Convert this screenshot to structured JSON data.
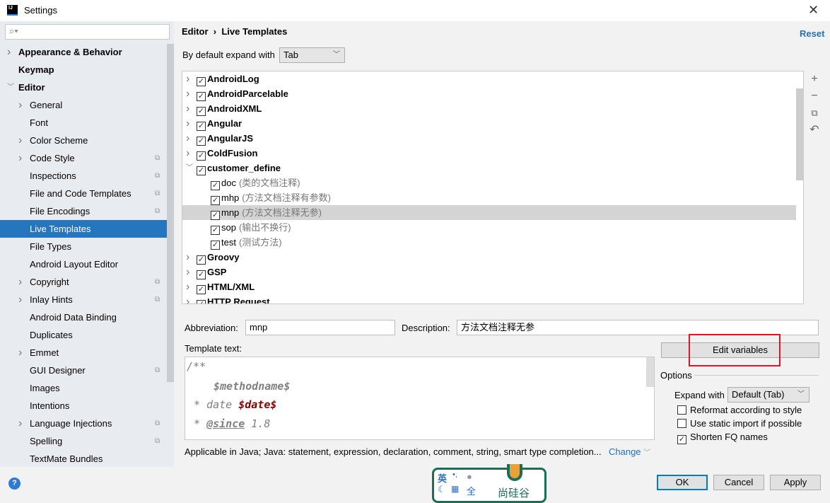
{
  "window": {
    "title": "Settings",
    "app_icon": "IJ"
  },
  "sidebar": {
    "search_placeholder": "",
    "items": [
      {
        "label": "Appearance & Behavior",
        "level": 0,
        "bold": true,
        "chevron": "right"
      },
      {
        "label": "Keymap",
        "level": 0,
        "bold": true
      },
      {
        "label": "Editor",
        "level": 0,
        "bold": true,
        "chevron": "down"
      },
      {
        "label": "General",
        "level": 1,
        "chevron": "right"
      },
      {
        "label": "Font",
        "level": 1
      },
      {
        "label": "Color Scheme",
        "level": 1,
        "chevron": "right"
      },
      {
        "label": "Code Style",
        "level": 1,
        "chevron": "right",
        "copy": true
      },
      {
        "label": "Inspections",
        "level": 1,
        "copy": true
      },
      {
        "label": "File and Code Templates",
        "level": 1,
        "copy": true
      },
      {
        "label": "File Encodings",
        "level": 1,
        "copy": true
      },
      {
        "label": "Live Templates",
        "level": 1,
        "selected": true
      },
      {
        "label": "File Types",
        "level": 1
      },
      {
        "label": "Android Layout Editor",
        "level": 1
      },
      {
        "label": "Copyright",
        "level": 1,
        "chevron": "right",
        "copy": true
      },
      {
        "label": "Inlay Hints",
        "level": 1,
        "chevron": "right",
        "copy": true
      },
      {
        "label": "Android Data Binding",
        "level": 1
      },
      {
        "label": "Duplicates",
        "level": 1
      },
      {
        "label": "Emmet",
        "level": 1,
        "chevron": "right"
      },
      {
        "label": "GUI Designer",
        "level": 1,
        "copy": true
      },
      {
        "label": "Images",
        "level": 1
      },
      {
        "label": "Intentions",
        "level": 1
      },
      {
        "label": "Language Injections",
        "level": 1,
        "chevron": "right",
        "copy": true
      },
      {
        "label": "Spelling",
        "level": 1,
        "copy": true
      },
      {
        "label": "TextMate Bundles",
        "level": 1
      }
    ]
  },
  "header": {
    "breadcrumb": [
      "Editor",
      "Live Templates"
    ],
    "reset": "Reset"
  },
  "expand": {
    "label": "By default expand with",
    "value": "Tab"
  },
  "tree": [
    {
      "name": "AndroidLog",
      "group": true,
      "checked": true
    },
    {
      "name": "AndroidParcelable",
      "group": true,
      "checked": true
    },
    {
      "name": "AndroidXML",
      "group": true,
      "checked": true
    },
    {
      "name": "Angular",
      "group": true,
      "checked": true
    },
    {
      "name": "AngularJS",
      "group": true,
      "checked": true
    },
    {
      "name": "ColdFusion",
      "group": true,
      "checked": true
    },
    {
      "name": "customer_define",
      "group": true,
      "checked": true,
      "expanded": true
    },
    {
      "name": "doc",
      "desc": "(类的文档注释)",
      "checked": true
    },
    {
      "name": "mhp",
      "desc": "(方法文档注释有参数)",
      "checked": true
    },
    {
      "name": "mnp",
      "desc": "(方法文档注释无参)",
      "checked": true,
      "selected": true
    },
    {
      "name": "sop",
      "desc": "(输出不换行)",
      "checked": true
    },
    {
      "name": "test",
      "desc": "(测试方法)",
      "checked": true
    },
    {
      "name": "Groovy",
      "group": true,
      "checked": true
    },
    {
      "name": "GSP",
      "group": true,
      "checked": true
    },
    {
      "name": "HTML/XML",
      "group": true,
      "checked": true
    },
    {
      "name": "HTTP Request",
      "group": true,
      "checked": true
    }
  ],
  "tree_tools": [
    "add-icon",
    "remove-icon",
    "copy-icon",
    "restore-icon"
  ],
  "form": {
    "abbreviation_label": "Abbreviation:",
    "abbreviation": "mnp",
    "description_label": "Description:",
    "description": "方法文档注释无参",
    "template_label": "Template text:",
    "edit_variables": "Edit variables"
  },
  "template": {
    "l1": "/**",
    "l2": "$methodname$",
    "l3a": "* date ",
    "l3b": "$date$",
    "l4a": "* ",
    "l4b": "@since",
    "l4c": " 1.8"
  },
  "applicable": {
    "text": "Applicable in Java; Java: statement, expression, declaration, comment, string, smart type completion...",
    "change": "Change"
  },
  "options": {
    "title": "Options",
    "expand_label": "Expand with",
    "expand_value": "Default (Tab)",
    "checks": [
      {
        "label": "Reformat according to style",
        "checked": false
      },
      {
        "label": "Use static import if possible",
        "checked": false
      },
      {
        "label": "Shorten FQ names",
        "checked": true
      }
    ]
  },
  "buttons": {
    "ok": "OK",
    "cancel": "Cancel",
    "apply": "Apply",
    "help": "?"
  },
  "ime": {
    "lang": "英",
    "punct": "•,",
    "width": "全",
    "logo_text": "尚硅谷"
  },
  "colors": {
    "selection": "#2675bf",
    "highlight": "#e81123",
    "link": "#2470c2"
  }
}
